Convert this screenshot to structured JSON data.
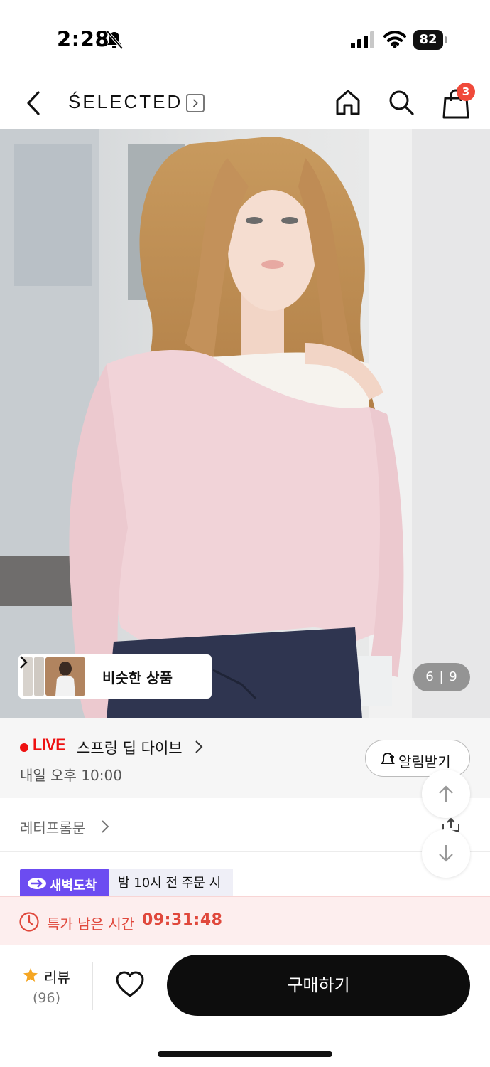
{
  "status_bar": {
    "time": "2:28",
    "battery": "82",
    "icons": [
      "bell-off-icon",
      "signal-icon",
      "wifi-icon",
      "battery-icon"
    ]
  },
  "nav": {
    "brand": "ŚELECTED",
    "cart_count": "3",
    "icons": [
      "back-icon",
      "home-icon",
      "search-icon",
      "shopping-bag-icon"
    ]
  },
  "hero": {
    "similar_label": "비슷한 상품",
    "page_current": "6",
    "page_total": "9",
    "page_text": "6 | 9"
  },
  "live": {
    "tag": "LIVE",
    "title": "스프링 딥 다이브",
    "time": "내일 오후 10:00",
    "notify_label": "알림받기"
  },
  "brand_row": {
    "label": "레터프롬문"
  },
  "delivery": {
    "badge": "새벽도착",
    "note": "밤 10시 전 주문 시"
  },
  "timer": {
    "label": "특가 남은 시간",
    "value": "09:31:48"
  },
  "bottom": {
    "review_label": "리뷰",
    "review_count": "(96)",
    "buy_label": "구매하기"
  },
  "colors": {
    "live_red": "#e11111",
    "delivery_purple": "#6c4cf1",
    "timer_red": "#e0483c",
    "timer_bg": "#fdeeee",
    "badge_red": "#f04a3a",
    "star": "#f5a623"
  }
}
